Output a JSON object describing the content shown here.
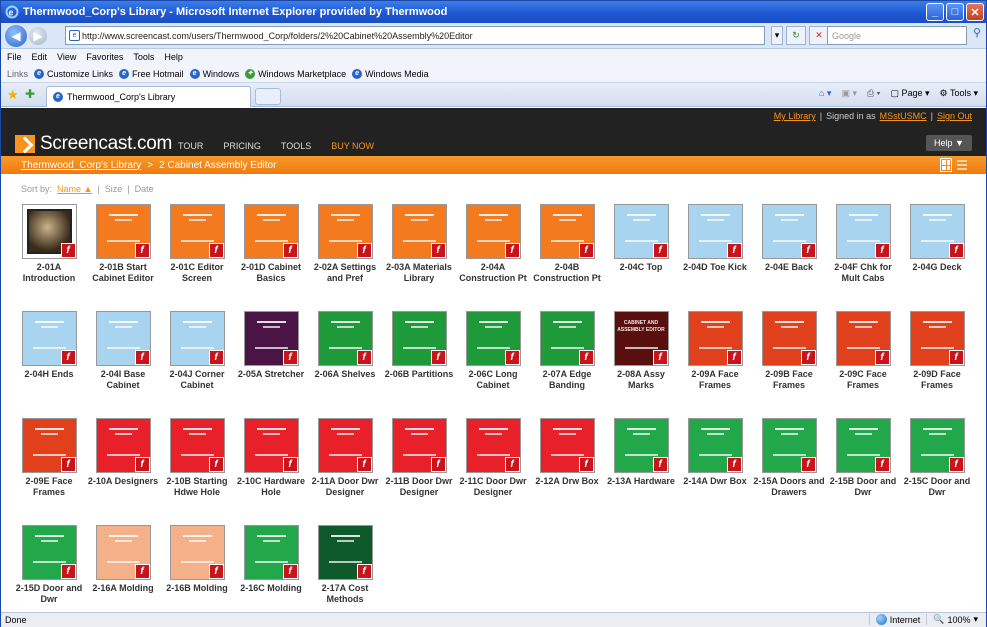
{
  "window": {
    "title": "Thermwood_Corp's Library - Microsoft Internet Explorer provided by Thermwood"
  },
  "address": {
    "url": "http://www.screencast.com/users/Thermwood_Corp/folders/2%20Cabinet%20Assembly%20Editor",
    "search_placeholder": "Google"
  },
  "menu": [
    "File",
    "Edit",
    "View",
    "Favorites",
    "Tools",
    "Help"
  ],
  "links": {
    "label": "Links",
    "items": [
      "Customize Links",
      "Free Hotmail",
      "Windows",
      "Windows Marketplace",
      "Windows Media"
    ]
  },
  "tab": {
    "title": "Thermwood_Corp's Library"
  },
  "command": {
    "page": "Page",
    "tools": "Tools"
  },
  "site": {
    "logo": "Screencast.com",
    "my_library": "My Library",
    "signed_in_prefix": "Signed in as",
    "user": "MSstUSMC",
    "sign_out": "Sign Out",
    "nav": [
      "TOUR",
      "PRICING",
      "TOOLS",
      "BUY NOW"
    ],
    "help": "Help ▼",
    "breadcrumb_root": "Thermwood_Corp's Library",
    "breadcrumb_sep": ">",
    "breadcrumb_current": "2 Cabinet Assembly Editor",
    "sort_label": "Sort by:",
    "sort_options": [
      "Name",
      "Size",
      "Date"
    ]
  },
  "items": [
    {
      "caption": "2-01A Introduction",
      "color": "#2b2118",
      "kind": "photo"
    },
    {
      "caption": "2-01B Start Cabinet Editor",
      "color": "#f47a20"
    },
    {
      "caption": "2-01C Editor Screen",
      "color": "#f47a20"
    },
    {
      "caption": "2-01D Cabinet Basics",
      "color": "#f47a20"
    },
    {
      "caption": "2-02A Settings and Pref",
      "color": "#f47a20"
    },
    {
      "caption": "2-03A Materials Library",
      "color": "#f47a20"
    },
    {
      "caption": "2-04A Construction Pt",
      "color": "#f47a20"
    },
    {
      "caption": "2-04B Construction Pt",
      "color": "#f47a20"
    },
    {
      "caption": "2-04C Top",
      "color": "#a8d4f0"
    },
    {
      "caption": "2-04D Toe Kick",
      "color": "#a8d4f0"
    },
    {
      "caption": "2-04E Back",
      "color": "#a8d4f0"
    },
    {
      "caption": "2-04F Chk for Mult Cabs",
      "color": "#a8d4f0"
    },
    {
      "caption": "2-04G Deck",
      "color": "#a8d4f0"
    },
    {
      "caption": "2-04H Ends",
      "color": "#a8d4f0"
    },
    {
      "caption": "2-04I Base Cabinet",
      "color": "#a8d4f0"
    },
    {
      "caption": "2-04J Corner Cabinet",
      "color": "#a8d4f0"
    },
    {
      "caption": "2-05A Stretcher",
      "color": "#4a1545"
    },
    {
      "caption": "2-06A Shelves",
      "color": "#1f9a3a"
    },
    {
      "caption": "2-06B Partitions",
      "color": "#1f9a3a"
    },
    {
      "caption": "2-06C Long Cabinet",
      "color": "#1f9a3a"
    },
    {
      "caption": "2-07A Edge Banding",
      "color": "#1f9a3a"
    },
    {
      "caption": "2-08A Assy Marks",
      "color": "#5a0f0f",
      "title": "CABINET AND ASSEMBLY EDITOR"
    },
    {
      "caption": "2-09A Face Frames",
      "color": "#e0401c"
    },
    {
      "caption": "2-09B Face Frames",
      "color": "#e0401c"
    },
    {
      "caption": "2-09C Face Frames",
      "color": "#e0401c"
    },
    {
      "caption": "2-09D Face Frames",
      "color": "#e0401c"
    },
    {
      "caption": "2-09E Face Frames",
      "color": "#e0401c"
    },
    {
      "caption": "2-10A Designers",
      "color": "#e8202a"
    },
    {
      "caption": "2-10B Starting Hdwe Hole",
      "color": "#e8202a"
    },
    {
      "caption": "2-10C Hardware Hole",
      "color": "#e8202a"
    },
    {
      "caption": "2-11A Door Dwr Designer",
      "color": "#e8202a"
    },
    {
      "caption": "2-11B Door Dwr Designer",
      "color": "#e8202a"
    },
    {
      "caption": "2-11C Door Dwr Designer",
      "color": "#e8202a"
    },
    {
      "caption": "2-12A Drw Box",
      "color": "#e8202a"
    },
    {
      "caption": "2-13A Hardware",
      "color": "#22a84a"
    },
    {
      "caption": "2-14A Dwr Box",
      "color": "#22a84a"
    },
    {
      "caption": "2-15A Doors and Drawers",
      "color": "#22a84a"
    },
    {
      "caption": "2-15B Door and Dwr",
      "color": "#22a84a"
    },
    {
      "caption": "2-15C Door and Dwr",
      "color": "#22a84a"
    },
    {
      "caption": "2-15D Door and Dwr",
      "color": "#22a84a"
    },
    {
      "caption": "2-16A Molding",
      "color": "#f4b088"
    },
    {
      "caption": "2-16B Molding",
      "color": "#f4b088"
    },
    {
      "caption": "2-16C Molding",
      "color": "#22a84a"
    },
    {
      "caption": "2-17A Cost Methods",
      "color": "#0f5a2a"
    }
  ],
  "status": {
    "left": "Done",
    "zone": "Internet",
    "zoom": "100%"
  }
}
